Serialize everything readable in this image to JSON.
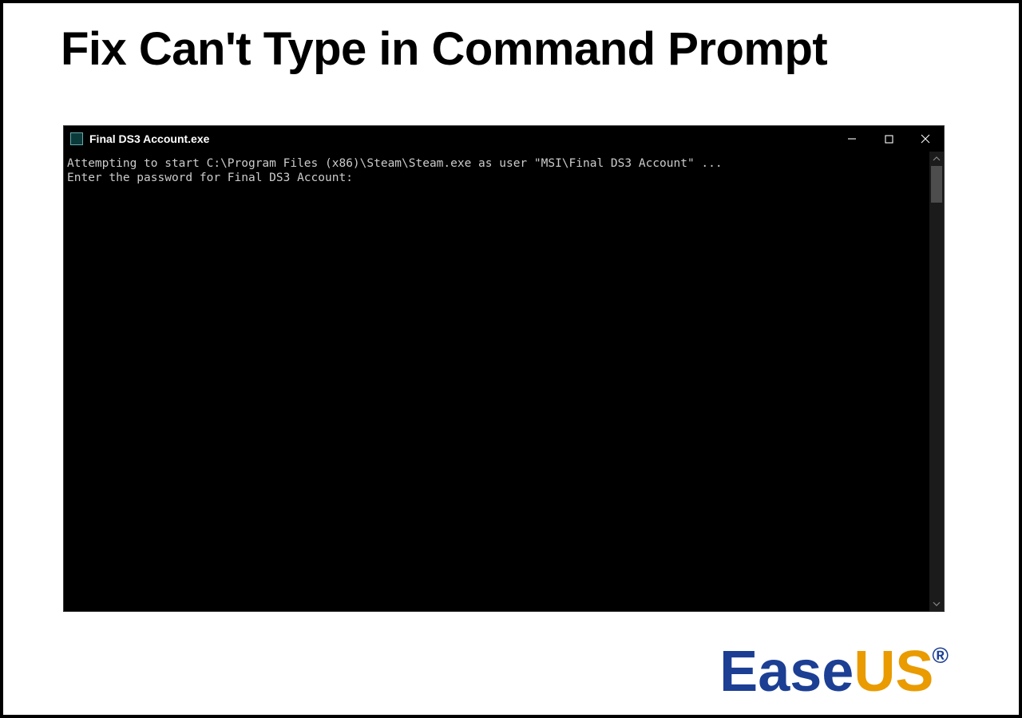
{
  "headline": "Fix Can't Type in Command Prompt",
  "cmd": {
    "title": "Final DS3 Account.exe",
    "line1": "Attempting to start C:\\Program Files (x86)\\Steam\\Steam.exe as user \"MSI\\Final DS3 Account\" ...",
    "line2": "Enter the password for Final DS3 Account:"
  },
  "logo": {
    "part1": "Ease",
    "part2": "US",
    "reg": "®"
  }
}
